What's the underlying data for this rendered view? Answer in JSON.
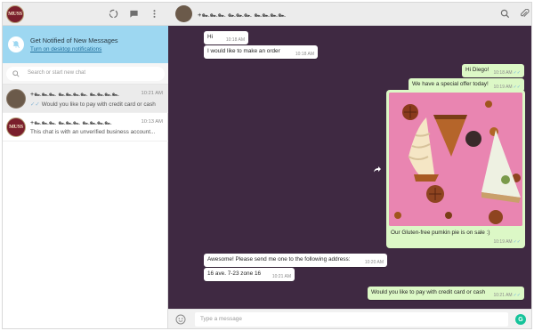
{
  "app": {
    "accent": "#9dd7f1",
    "chat_background": "#3f2942",
    "outgoing_bubble_color": "#dcf8c6"
  },
  "sidebar": {
    "logo_text": "MUSS",
    "header_icons": [
      "status-icon",
      "new-chat-icon",
      "menu-icon"
    ],
    "notification": {
      "title": "Get Notified of New Messages",
      "link": "Turn on desktop notifications"
    },
    "search": {
      "placeholder": "Search or start new chat"
    },
    "chats": [
      {
        "name": "+๛๛๛ ๛๛๛๛ ๛๛๛๛",
        "time": "10:21 AM",
        "preview": "Would you like to pay with credit card or cash",
        "ticks": "✓✓"
      },
      {
        "name": "+๛๛๛ ๛๛๛ ๛๛๛๛",
        "time": "10:13 AM",
        "preview": "This chat is with an unverified business account...",
        "ticks": ""
      }
    ]
  },
  "conversation": {
    "contact_name": "+๛๛๛ ๛๛๛ ๛๛๛๛",
    "header_icons": [
      "search-icon",
      "attach-icon"
    ],
    "messages": [
      {
        "text": "Hi",
        "time": "10:18 AM",
        "direction": "in"
      },
      {
        "text": "I would like to make an order",
        "time": "10:18 AM",
        "direction": "in"
      },
      {
        "text": "Hi Diego!",
        "time": "10:18 AM",
        "direction": "out",
        "ticks": "✓✓"
      },
      {
        "text": "We have a special offer today!",
        "time": "10:19 AM",
        "direction": "out",
        "ticks": "✓✓"
      },
      {
        "text": "Our Gluten-free pumkin pie is on sale :)",
        "time": "10:19 AM",
        "direction": "out",
        "ticks": "✓✓",
        "has_image": true
      },
      {
        "text": "Awesome! Please send me one to the following address:",
        "time": "10:20 AM",
        "direction": "in"
      },
      {
        "text": "16 ave. 7-23 zone 16",
        "time": "10:21 AM",
        "direction": "in"
      },
      {
        "text": "Would you like to pay with credit card or cash",
        "time": "10:21 AM",
        "direction": "out",
        "ticks": "✓✓"
      }
    ],
    "composer": {
      "placeholder": "Type a message",
      "grammarly_badge": "G"
    }
  }
}
